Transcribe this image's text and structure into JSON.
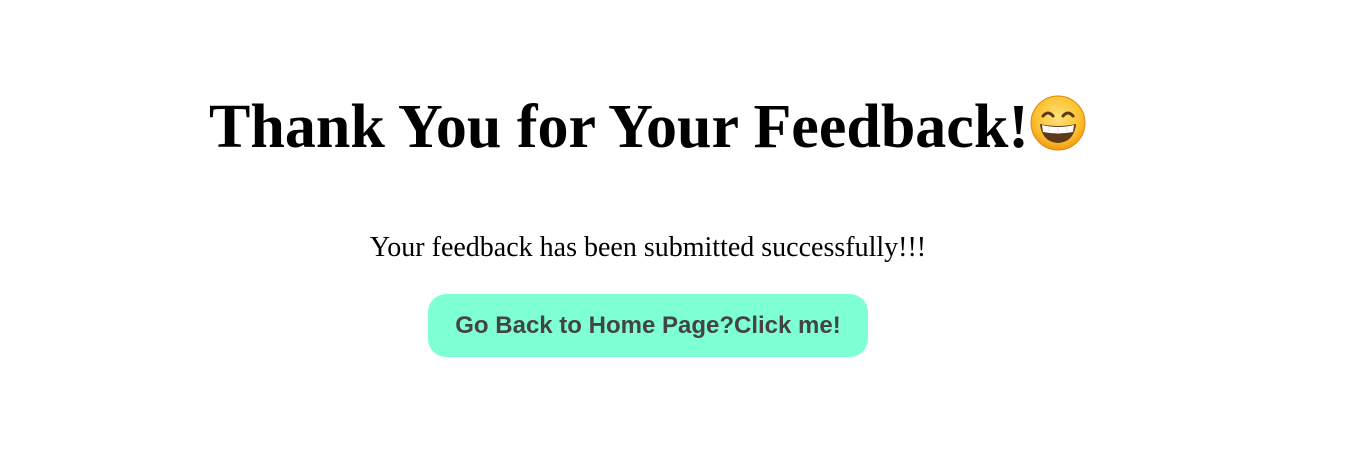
{
  "main": {
    "title": "Thank You for Your Feedback!",
    "title_emoji": "grinning-face-with-smiling-eyes-icon",
    "message": "Your feedback has been submitted successfully!!!",
    "home_button_label": "Go Back to Home Page?Click me!"
  },
  "colors": {
    "background": "#ffffff",
    "button_background": "#7fffd4",
    "button_text": "#444444",
    "text": "#000000"
  }
}
